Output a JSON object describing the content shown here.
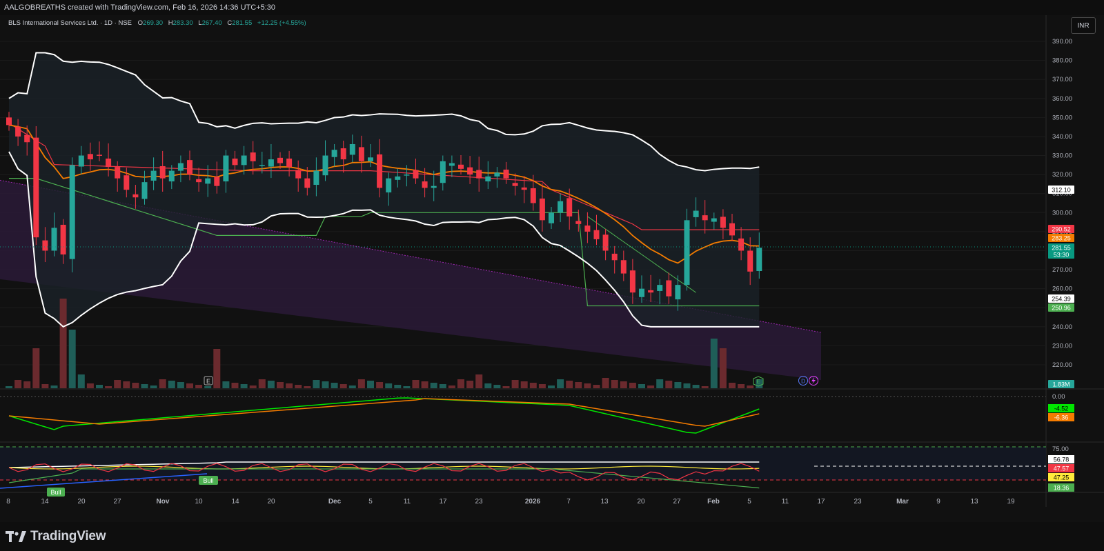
{
  "header": {
    "credit": "AALGOBREATHS created with TradingView.com, Feb 16, 2026 14:36 UTC+5:30"
  },
  "legend": {
    "symbol": "BLS International Services Ltd. · 1D · NSE",
    "o_label": "O",
    "o_value": "269.30",
    "h_label": "H",
    "h_value": "283.30",
    "l_label": "L",
    "l_value": "267.40",
    "c_label": "C",
    "c_value": "281.55",
    "change": "+12.25 (+4.55%)"
  },
  "currency_button": "INR",
  "price_axis": {
    "ticks": [
      "390.00",
      "380.00",
      "370.00",
      "360.00",
      "350.00",
      "340.00",
      "330.00",
      "320.00",
      "310.00",
      "300.00",
      "290.00",
      "280.00",
      "270.00",
      "260.00",
      "250.00",
      "240.00",
      "230.00",
      "220.00"
    ],
    "badges": [
      {
        "text": "312.10",
        "bg": "#ffffff",
        "fg": "#000000"
      },
      {
        "text": "290.52",
        "bg": "#f23645",
        "fg": "#ffffff"
      },
      {
        "text": "283.25",
        "bg": "#f57c00",
        "fg": "#ffffff"
      },
      {
        "text": "281.55",
        "bg": "#089981",
        "fg": "#ffffff"
      },
      {
        "text": "53:30",
        "bg": "#089981",
        "fg": "#ffffff"
      },
      {
        "text": "254.39",
        "bg": "#ffffff",
        "fg": "#000000"
      },
      {
        "text": "250.96",
        "bg": "#4caf50",
        "fg": "#ffffff"
      },
      {
        "text": "1.83M",
        "bg": "#26a69a",
        "fg": "#ffffff"
      }
    ]
  },
  "pane2": {
    "ticks": [
      "0.00"
    ],
    "badges": [
      {
        "text": "-4.52",
        "bg": "#00e600",
        "fg": "#000000"
      },
      {
        "text": "-6.36",
        "bg": "#f57c00",
        "fg": "#ffffff"
      }
    ]
  },
  "pane3": {
    "ticks": [
      "75.00"
    ],
    "badges": [
      {
        "text": "56.78",
        "bg": "#ffffff",
        "fg": "#000000"
      },
      {
        "text": "47.57",
        "bg": "#f23645",
        "fg": "#ffffff"
      },
      {
        "text": "47.25",
        "bg": "#ffeb3b",
        "fg": "#000000"
      },
      {
        "text": "18.36",
        "bg": "#4caf50",
        "fg": "#ffffff"
      }
    ],
    "labels": [
      "Bull",
      "Bull"
    ]
  },
  "time_axis": [
    "8",
    "14",
    "20",
    "27",
    "Nov",
    "10",
    "14",
    "20",
    "Dec",
    "5",
    "11",
    "17",
    "23",
    "2026",
    "7",
    "13",
    "20",
    "27",
    "Feb",
    "5",
    "11",
    "17",
    "23",
    "Mar",
    "9",
    "13",
    "19"
  ],
  "markers": {
    "earnings": "E",
    "dividend": "D"
  },
  "footer": {
    "brand": "TradingView"
  },
  "colors": {
    "up": "#26a69a",
    "down": "#f23645",
    "bands": "#ffffff",
    "ema": "#f57c00",
    "stop_red": "#f23645",
    "stop_green": "#4caf50",
    "channel_fill": "#2d1b3d"
  },
  "chart_data": {
    "type": "candlestick",
    "ohlc_last": {
      "open": 269.3,
      "high": 283.3,
      "low": 267.4,
      "close": 281.55
    },
    "closes": [
      346,
      340,
      337,
      287,
      280,
      292,
      278,
      325,
      330,
      328,
      330,
      324,
      318,
      312,
      308,
      316,
      322,
      318,
      322,
      326,
      320,
      316,
      318,
      314,
      330,
      325,
      330,
      327,
      325,
      328,
      326,
      324,
      318,
      313,
      322,
      330,
      333,
      328,
      336,
      327,
      329,
      313,
      318,
      319,
      320,
      318,
      313,
      314,
      327,
      326,
      323,
      320,
      318,
      319,
      321,
      318,
      314,
      312,
      305,
      296,
      300,
      306,
      298,
      294,
      290,
      286,
      280,
      275,
      268,
      258,
      260,
      258,
      262,
      256,
      262,
      296,
      301,
      296,
      297,
      292,
      288,
      280,
      269,
      281.55
    ],
    "ylim": [
      212,
      395
    ],
    "series": [
      {
        "name": "Upper band",
        "last": 312.1
      },
      {
        "name": "Trailing stop",
        "last": 290.52
      },
      {
        "name": "EMA",
        "last": 283.25
      },
      {
        "name": "Lower band",
        "last": 254.39
      },
      {
        "name": "Support",
        "last": 250.96
      }
    ],
    "volume_last": "1.83M"
  }
}
